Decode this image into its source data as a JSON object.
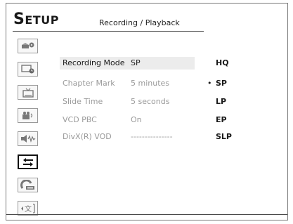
{
  "header": {
    "title_first": "S",
    "title_rest": "ETUP",
    "subtitle": "Recording / Playback"
  },
  "sidebar": {
    "icons": [
      {
        "name": "disc-settings-icon",
        "active": false
      },
      {
        "name": "tv-clock-icon",
        "active": false
      },
      {
        "name": "tv-icon",
        "active": false
      },
      {
        "name": "video-audio-icon",
        "active": false
      },
      {
        "name": "speaker-audio-icon",
        "active": false
      },
      {
        "name": "recording-playback-icon",
        "active": true
      },
      {
        "name": "dvd-disc-icon",
        "active": false
      },
      {
        "name": "language-icon",
        "active": false
      }
    ]
  },
  "settings": [
    {
      "label": "Recording Mode",
      "value": "SP",
      "active": true
    },
    {
      "label": "Chapter Mark",
      "value": "5 minutes",
      "active": false
    },
    {
      "label": "Slide Time",
      "value": "5 seconds",
      "active": false
    },
    {
      "label": "VCD PBC",
      "value": "On",
      "active": false
    },
    {
      "label": "DivX(R) VOD",
      "value": "---------------",
      "active": false
    }
  ],
  "options": {
    "bullet": "•",
    "selected_index": 1,
    "items": [
      "HQ",
      "SP",
      "LP",
      "EP",
      "SLP"
    ]
  }
}
